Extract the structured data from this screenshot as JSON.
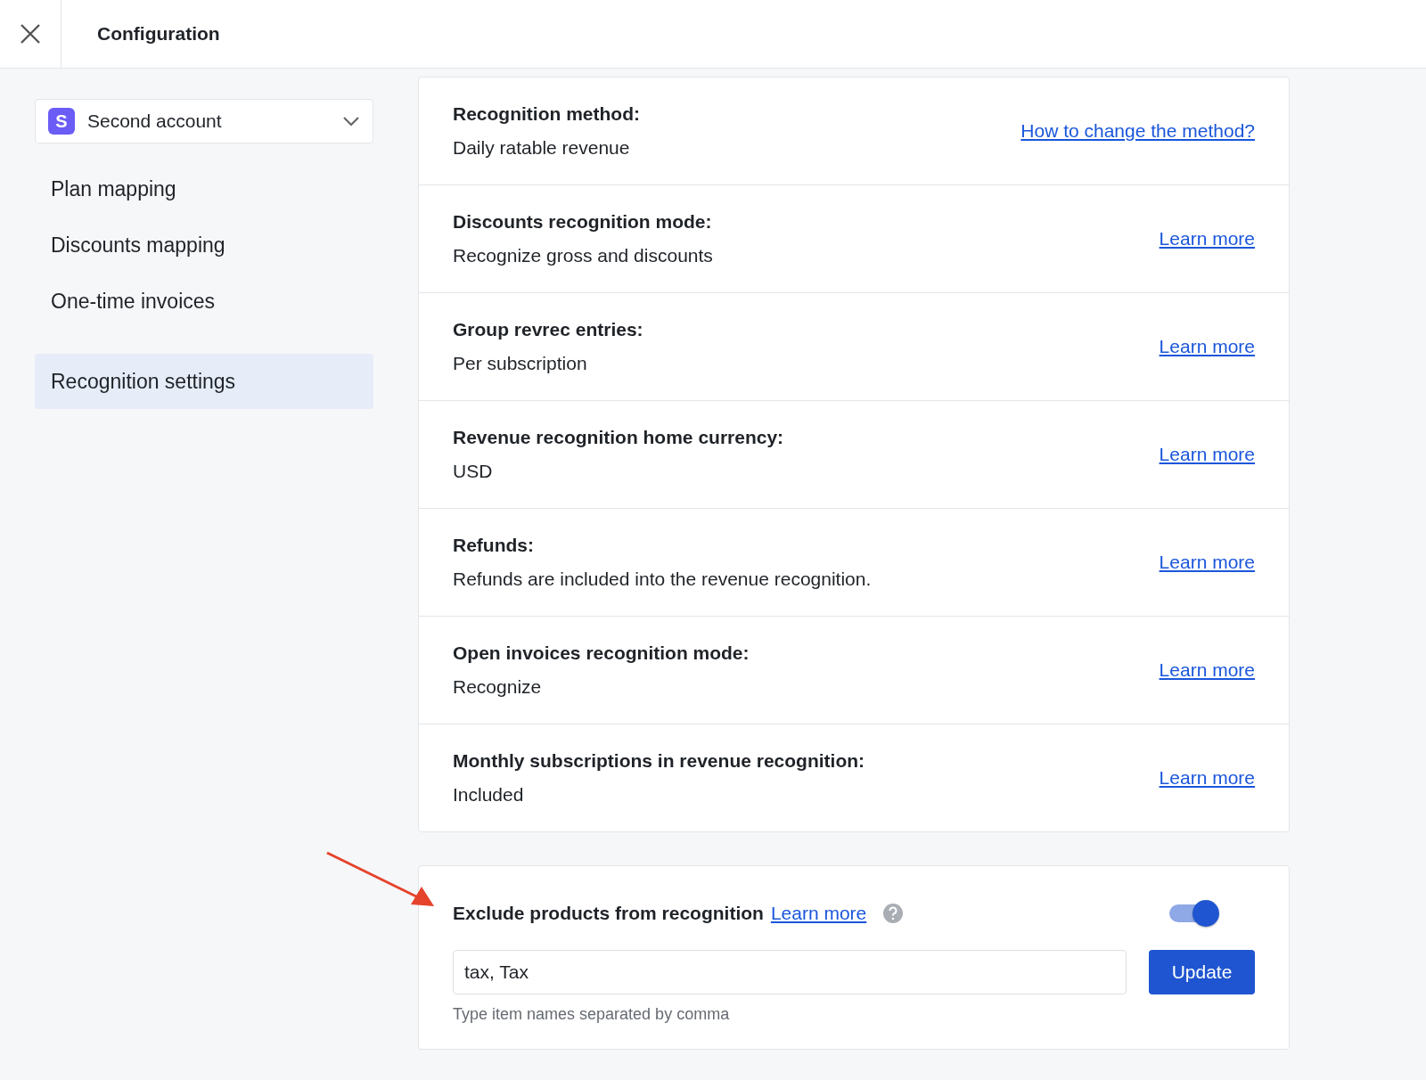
{
  "header": {
    "title": "Configuration"
  },
  "sidebar": {
    "account": {
      "badge": "S",
      "name": "Second account"
    },
    "items": [
      {
        "label": "Plan mapping",
        "selected": false
      },
      {
        "label": "Discounts mapping",
        "selected": false
      },
      {
        "label": "One-time invoices",
        "selected": false
      },
      {
        "label": "Recognition settings",
        "selected": true
      }
    ]
  },
  "settings": [
    {
      "title": "Recognition method:",
      "value": "Daily ratable revenue",
      "link": "How to change the method?"
    },
    {
      "title": "Discounts recognition mode:",
      "value": "Recognize gross and discounts",
      "link": "Learn more"
    },
    {
      "title": "Group revrec entries:",
      "value": "Per subscription",
      "link": "Learn more"
    },
    {
      "title": "Revenue recognition home currency:",
      "value": "USD",
      "link": "Learn more"
    },
    {
      "title": "Refunds:",
      "value": "Refunds are included into the revenue recognition.",
      "link": "Learn more"
    },
    {
      "title": "Open invoices recognition mode:",
      "value": "Recognize",
      "link": "Learn more"
    },
    {
      "title": "Monthly subscriptions in revenue recognition:",
      "value": "Included",
      "link": "Learn more"
    }
  ],
  "exclude": {
    "title": "Exclude products from recognition",
    "link": "Learn more",
    "on": true,
    "value": "tax, Tax",
    "hint": "Type item names separated by comma",
    "button": "Update"
  }
}
